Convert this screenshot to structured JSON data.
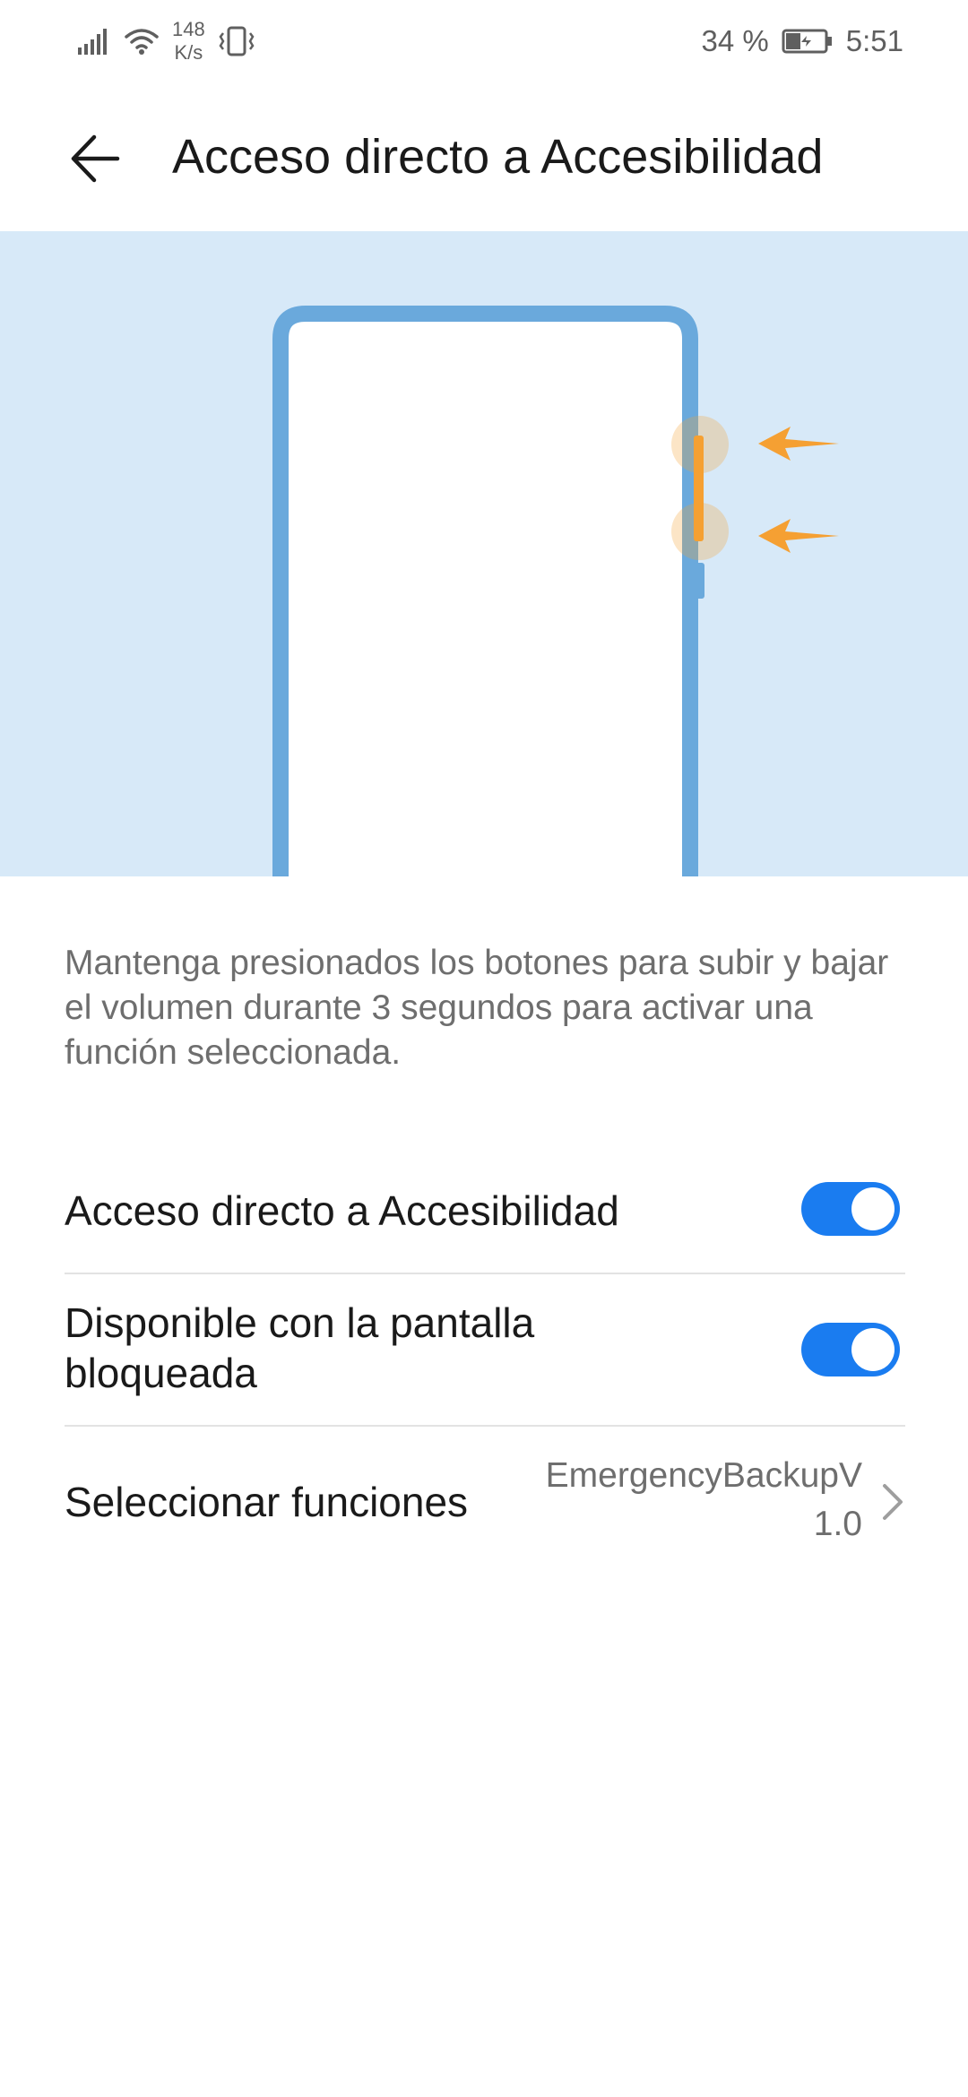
{
  "status_bar": {
    "net_speed_value": "148",
    "net_speed_unit": "K/s",
    "battery": "34 %",
    "time": "5:51",
    "icons": [
      "signal-icon",
      "wifi-icon",
      "vibrate-icon",
      "battery-charging-icon"
    ]
  },
  "header": {
    "title": "Acceso directo a Accesibilidad",
    "back_icon": "arrow-back-icon"
  },
  "illustration": {
    "frame_color": "#6aa9dc",
    "background_color": "#d7e9f8",
    "highlight_color": "#f5a033",
    "icons": [
      "phone-outline",
      "arrow-left-icon",
      "arrow-left-icon"
    ]
  },
  "description": "Mantenga presionados los botones para subir y bajar el volumen durante 3 segundos para activar una función seleccionada.",
  "settings": {
    "shortcut": {
      "label": "Acceso directo a Accesibilidad",
      "enabled": true
    },
    "lock_screen": {
      "label_line1": "Disponible con la pantalla",
      "label_line2": "bloqueada",
      "enabled": true
    },
    "select_functions": {
      "label": "Seleccionar funciones",
      "value_line1": "EmergencyBackupV",
      "value_line2": "1.0"
    }
  },
  "colors": {
    "accent": "#1a7cf0",
    "text_primary": "#1a1a1a",
    "text_secondary": "#6e6e6e"
  }
}
